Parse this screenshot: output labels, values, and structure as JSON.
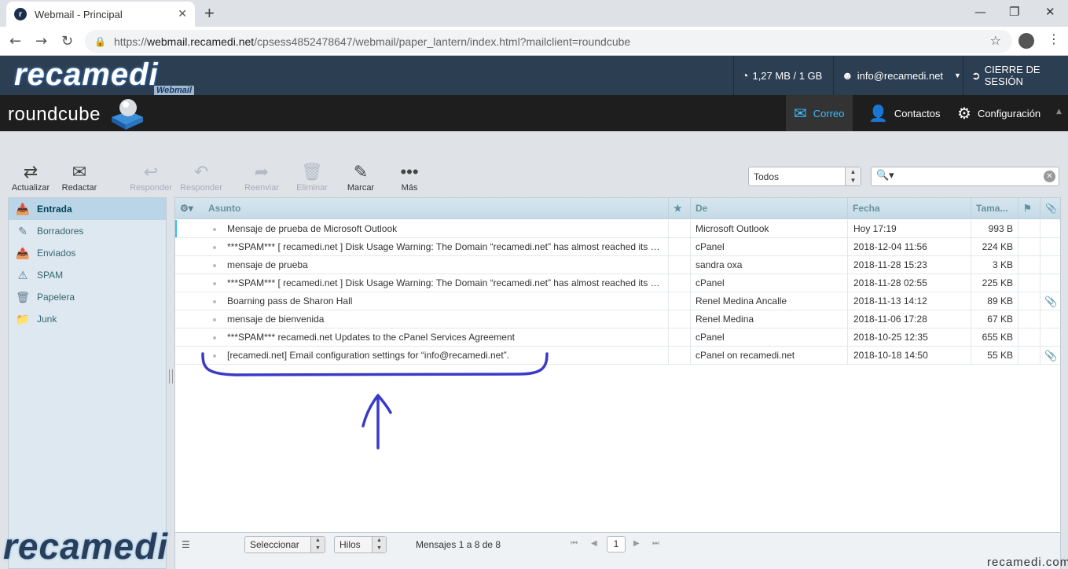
{
  "browser": {
    "tab_title": "Webmail - Principal",
    "favicon_letter": "r",
    "new_tab": "+",
    "close_tab": "✕",
    "url_prefix": "https://",
    "url_host": "webmail.recamedi.net",
    "url_path": "/cpsess4852478647/webmail/paper_lantern/index.html?mailclient=roundcube"
  },
  "header": {
    "brand": "recamedi",
    "brand_sub": "Webmail",
    "quota": "1,27 MB / 1 GB",
    "user": "info@recamedi.net",
    "logout": "CIERRE DE SESIÓN"
  },
  "rcbar": {
    "logo": "roundcube",
    "nav": [
      {
        "label": "Correo",
        "icon": "envelope-icon",
        "active": true
      },
      {
        "label": "Contactos",
        "icon": "user-icon",
        "active": false
      },
      {
        "label": "Configuración",
        "icon": "gear-icon",
        "active": false
      }
    ]
  },
  "toolbar": {
    "buttons": [
      {
        "label": "Actualizar",
        "icon": "refresh-icon",
        "enabled": true
      },
      {
        "label": "Redactar",
        "icon": "compose-icon",
        "enabled": true
      },
      {
        "label": "Responder",
        "icon": "reply-icon",
        "enabled": false
      },
      {
        "label": "Responder ...",
        "icon": "reply-all-icon",
        "enabled": false
      },
      {
        "label": "Reenviar",
        "icon": "forward-icon",
        "enabled": false
      },
      {
        "label": "Eliminar",
        "icon": "trash-icon",
        "enabled": false
      },
      {
        "label": "Marcar",
        "icon": "mark-icon",
        "enabled": true
      },
      {
        "label": "Más",
        "icon": "more-icon",
        "enabled": true
      }
    ],
    "filter_value": "Todos",
    "search_placeholder": ""
  },
  "folders": [
    {
      "label": "Entrada",
      "icon": "inbox-icon",
      "active": true
    },
    {
      "label": "Borradores",
      "icon": "pencil-icon",
      "active": false
    },
    {
      "label": "Enviados",
      "icon": "sent-icon",
      "active": false
    },
    {
      "label": "SPAM",
      "icon": "spam-icon",
      "active": false
    },
    {
      "label": "Papelera",
      "icon": "trash-icon",
      "active": false
    },
    {
      "label": "Junk",
      "icon": "folder-icon",
      "active": false
    }
  ],
  "list": {
    "columns": {
      "subject": "Asunto",
      "from": "De",
      "date": "Fecha",
      "size": "Tama..."
    },
    "messages": [
      {
        "subject": "Mensaje de prueba de Microsoft Outlook",
        "from": "Microsoft Outlook",
        "date": "Hoy 17:19",
        "size": "993 B",
        "attachment": false
      },
      {
        "subject": "***SPAM*** [ recamedi.net ] Disk Usage Warning: The Domain “recamedi.net” has almost reached its disk quota.",
        "from": "cPanel",
        "date": "2018-12-04 11:56",
        "size": "224 KB",
        "attachment": false
      },
      {
        "subject": "mensaje de prueba",
        "from": "sandra oxa",
        "date": "2018-11-28 15:23",
        "size": "3 KB",
        "attachment": false
      },
      {
        "subject": "***SPAM*** [ recamedi.net ] Disk Usage Warning: The Domain “recamedi.net” has almost reached its disk quota.",
        "from": "cPanel",
        "date": "2018-11-28 02:55",
        "size": "225 KB",
        "attachment": false
      },
      {
        "subject": "Boarning pass de Sharon Hall",
        "from": "Renel Medina Ancalle",
        "date": "2018-11-13 14:12",
        "size": "89 KB",
        "attachment": true
      },
      {
        "subject": "mensaje de bienvenida",
        "from": "Renel Medina",
        "date": "2018-11-06 17:28",
        "size": "67 KB",
        "attachment": false
      },
      {
        "subject": "***SPAM*** recamedi.net Updates to the cPanel Services Agreement",
        "from": "cPanel",
        "date": "2018-10-25 12:35",
        "size": "655 KB",
        "attachment": false
      },
      {
        "subject": "[recamedi.net] Email configuration settings for “info@recamedi.net”.",
        "from": "cPanel on recamedi.net",
        "date": "2018-10-18 14:50",
        "size": "55 KB",
        "attachment": true
      }
    ]
  },
  "footer": {
    "select_label": "Seleccionar",
    "threads_label": "Hilos",
    "count": "Mensajes 1 a 8 de 8",
    "page": "1"
  },
  "watermark": {
    "logo": "recamedi",
    "text": "recamedi.com"
  },
  "colors": {
    "annotation": "#3a3ac8",
    "active_nav": "#37beff",
    "header_bg": "#2c3e52"
  }
}
